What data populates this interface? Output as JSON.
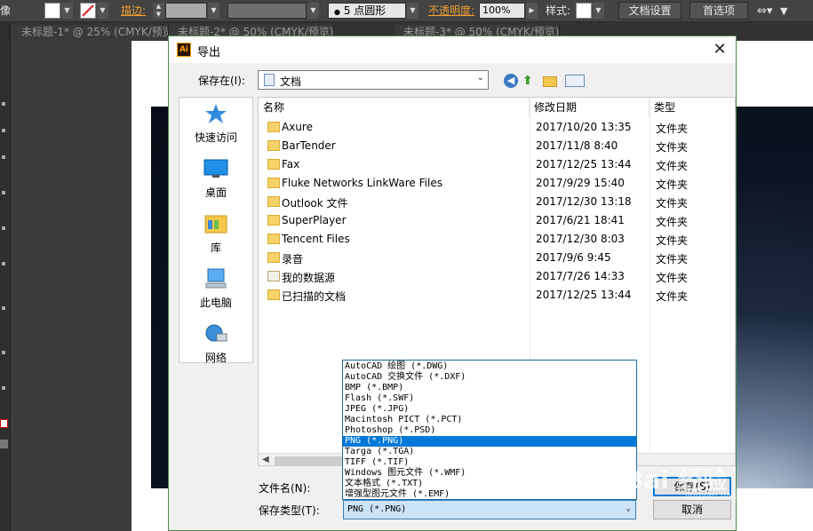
{
  "illustrator": {
    "control_bar": {
      "left_label": "像",
      "stroke_label": "描边:",
      "brush_label": "5 点圆形",
      "opacity_label": "不透明度:",
      "opacity_value": "100%",
      "style_label": "样式:",
      "doc_setup_button": "文档设置",
      "preferences_button": "首选项"
    },
    "tabs": [
      "未标题-1* @ 25% (CMYK/预览)",
      "未标题-2* @ 50% (CMYK/预览)",
      "未标题-3* @ 50% (CMYK/预览)"
    ]
  },
  "dialog": {
    "title": "导出",
    "save_in_label": "保存在(I):",
    "save_in_value": "文档",
    "places": [
      {
        "label": "快速访问",
        "icon": "star-icon"
      },
      {
        "label": "桌面",
        "icon": "desktop-icon"
      },
      {
        "label": "库",
        "icon": "library-icon"
      },
      {
        "label": "此电脑",
        "icon": "computer-icon"
      },
      {
        "label": "网络",
        "icon": "network-icon"
      }
    ],
    "columns": {
      "name": "名称",
      "date": "修改日期",
      "type": "类型"
    },
    "files": [
      {
        "name": "Axure",
        "date": "2017/10/20 13:35",
        "type": "文件夹"
      },
      {
        "name": "BarTender",
        "date": "2017/11/8 8:40",
        "type": "文件夹"
      },
      {
        "name": "Fax",
        "date": "2017/12/25 13:44",
        "type": "文件夹"
      },
      {
        "name": "Fluke Networks LinkWare Files",
        "date": "2017/9/29 15:40",
        "type": "文件夹"
      },
      {
        "name": "Outlook 文件",
        "date": "2017/12/30 13:18",
        "type": "文件夹"
      },
      {
        "name": "SuperPlayer",
        "date": "2017/6/21 18:41",
        "type": "文件夹"
      },
      {
        "name": "Tencent Files",
        "date": "2017/12/30 8:03",
        "type": "文件夹"
      },
      {
        "name": "录音",
        "date": "2017/9/6 9:45",
        "type": "文件夹"
      },
      {
        "name": "我的数据源",
        "date": "2017/7/26 14:33",
        "type": "文件夹"
      },
      {
        "name": "已扫描的文档",
        "date": "2017/12/25 13:44",
        "type": "文件夹"
      }
    ],
    "filename_label": "文件名(N):",
    "filetype_label": "保存类型(T):",
    "filetype_value": "PNG (*.PNG)",
    "save_button": "保存(S)",
    "cancel_button": "取消",
    "filetype_options": [
      "AutoCAD 绘图 (*.DWG)",
      "AutoCAD 交换文件 (*.DXF)",
      "BMP (*.BMP)",
      "Flash (*.SWF)",
      "JPEG (*.JPG)",
      "Macintosh PICT (*.PCT)",
      "Photoshop (*.PSD)",
      "PNG (*.PNG)",
      "Targa (*.TGA)",
      "TIFF (*.TIF)",
      "Windows 图元文件 (*.WMF)",
      "文本格式 (*.TXT)",
      "增强型图元文件 (*.EMF)"
    ],
    "selected_option_index": 7
  },
  "watermark": {
    "text": "Bai 经验",
    "sub": "jingyan.baidu.com"
  },
  "colors": {
    "accent": "#0078d7",
    "folder": "#f6d26a",
    "selection": "#0078d7"
  }
}
